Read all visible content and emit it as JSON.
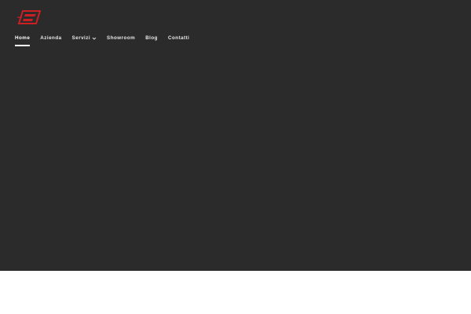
{
  "colors": {
    "hero_background": "#2b2b2b",
    "nav_text": "#e9e9e9",
    "nav_active": "#ffffff",
    "logo_red": "#cc1f24",
    "page_background": "#ffffff"
  },
  "header": {
    "logo": {
      "icon": "brand-logo-icon"
    },
    "nav": {
      "items": [
        {
          "label": "Home",
          "active": true
        },
        {
          "label": "Azienda",
          "active": false
        },
        {
          "label": "Servizi",
          "active": false,
          "has_dropdown": true,
          "icon": "chevron-down-icon"
        },
        {
          "label": "Showroom",
          "active": false
        },
        {
          "label": "Blog",
          "active": false
        },
        {
          "label": "Contatti",
          "active": false
        }
      ]
    }
  }
}
